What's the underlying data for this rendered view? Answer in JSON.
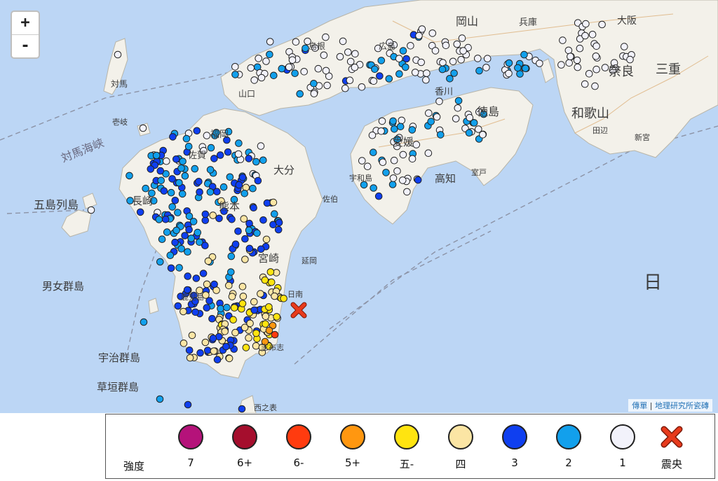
{
  "map": {
    "zoom_in": "+",
    "zoom_out": "-",
    "attribution_prefix": "傳單",
    "attribution_sep": " | ",
    "attribution_source": "地理研究所瓷磚",
    "labels": {
      "miyazaki": "宮崎",
      "kagoshima": "鹿児島",
      "nagasaki": "長崎",
      "kumamoto": "熊本",
      "oita": "大分",
      "ehime": "愛媛",
      "kochi": "高知",
      "tokushima": "徳島",
      "kagawa": "香川",
      "okayama": "岡山",
      "hyogo": "兵庫",
      "osaka": "大阪",
      "wakayama": "和歌山",
      "nara": "奈良",
      "mie": "三重",
      "shimane": "島根",
      "yamaguchi": "山口",
      "hiroshima": "広島",
      "fukuoka": "福岡",
      "saga": "佐賀",
      "tsushima": "対馬",
      "iki": "壱岐",
      "goto": "五島列島",
      "danjo": "男女群島",
      "uji": "宇治群島",
      "kusagaki": "草垣群島",
      "tsushima_strait": "対馬海峡",
      "nichinan": "日南",
      "nobeoka": "延岡",
      "hi": "日",
      "muroto": "室戸",
      "shingu": "新宮",
      "tanabe": "田辺",
      "uwajima": "宇和島",
      "saiki": "佐伯",
      "hirado": "平戸",
      "fukue": "福江島",
      "shibushi": "志布志",
      "nishinoomote": "西之表"
    },
    "epicenter": "震央",
    "colors": {
      "sea": "#bcd6f5",
      "land": "#f3f1ea"
    }
  },
  "legend": {
    "title": "強度",
    "items": [
      {
        "label": "7",
        "color": "#b5127a"
      },
      {
        "label": "6+",
        "color": "#a50e2d"
      },
      {
        "label": "6-",
        "color": "#ff3b0f"
      },
      {
        "label": "5+",
        "color": "#ff9710"
      },
      {
        "label": "五-",
        "color": "#ffe410"
      },
      {
        "label": "四",
        "color": "#fbe5a4"
      },
      {
        "label": "3",
        "color": "#0f3ff0"
      },
      {
        "label": "2",
        "color": "#12a0ec"
      },
      {
        "label": "1",
        "color": "#f2f2fb"
      }
    ],
    "epicenter_label": "震央",
    "epicenter_color": "#e83a1c"
  }
}
